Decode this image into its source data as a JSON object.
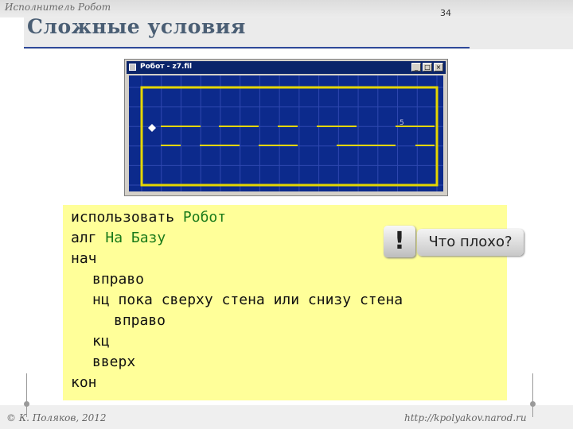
{
  "slide": {
    "section": "Исполнитель Робот",
    "title": "Сложные условия",
    "page_number": "34",
    "copyright": "© К. Поляков, 2012",
    "url": "http://kpolyakov.narod.ru"
  },
  "robot_window": {
    "title": "Робот - z7.fil",
    "cell_number": "5",
    "colors": {
      "field": "#0c2a8c",
      "grid": "#2f48b0",
      "wall": "#e5d600"
    }
  },
  "code": {
    "lines": [
      {
        "keyword": "использовать",
        "rest": "Робот"
      },
      {
        "keyword": "алг",
        "rest": "На Базу"
      },
      {
        "keyword": "нач",
        "rest": ""
      },
      {
        "keyword": "вправо",
        "rest": ""
      },
      {
        "keyword": "нц пока сверху стена или снизу стена",
        "rest": ""
      },
      {
        "keyword": "вправо",
        "rest": ""
      },
      {
        "keyword": "кц",
        "rest": ""
      },
      {
        "keyword": "вверх",
        "rest": ""
      },
      {
        "keyword": "кон",
        "rest": ""
      }
    ]
  },
  "callout": {
    "icon": "exclamation-icon",
    "mark": "!",
    "text": "Что плохо?"
  }
}
